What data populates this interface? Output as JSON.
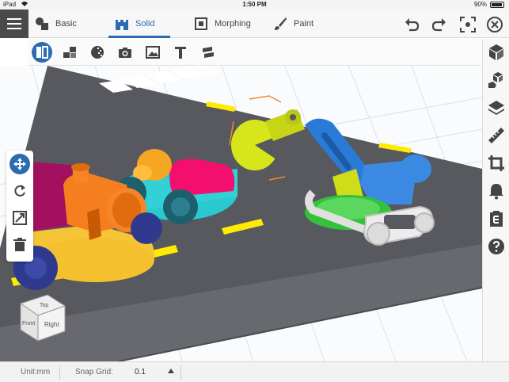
{
  "status_bar": {
    "carrier": "iPad",
    "time": "1:50 PM",
    "battery": "90%"
  },
  "modes": [
    {
      "label": "Basic",
      "icon": "shapes-icon"
    },
    {
      "label": "Solid",
      "icon": "castle-icon",
      "active": true
    },
    {
      "label": "Morphing",
      "icon": "morph-icon"
    },
    {
      "label": "Paint",
      "icon": "brush-icon"
    }
  ],
  "top_actions": [
    "undo-icon",
    "redo-icon",
    "fullscreen-icon",
    "close-icon"
  ],
  "tools": [
    "split-icon",
    "boxes-icon",
    "dither-icon",
    "camera-icon",
    "image-icon",
    "text-icon",
    "layers-cut-icon"
  ],
  "right_tools": [
    "cube-icon",
    "hand-cube-icon",
    "layers-icon",
    "ruler-icon",
    "crop-icon",
    "bell-icon",
    "export-icon",
    "help-icon"
  ],
  "left_tools": [
    "move-icon",
    "rotate-icon",
    "scale-icon",
    "trash-icon"
  ],
  "view_cube": {
    "top": "Top",
    "front": "Front",
    "right": "Right"
  },
  "bottom": {
    "unit": "Unit:mm",
    "snap_label": "Snap Grid:",
    "snap_value": "0.1"
  },
  "colors": {
    "accent": "#2b6cb0",
    "road": "#5a5a63",
    "lane": "#ffeb00",
    "grid": "#cfe0f2"
  }
}
